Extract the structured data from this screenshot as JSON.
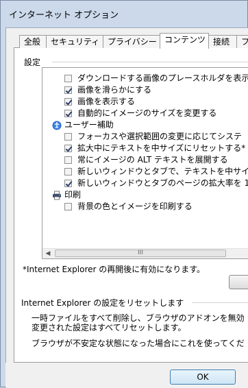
{
  "window": {
    "title": "インターネット オプション"
  },
  "tabs": [
    {
      "label": "全般",
      "active": false
    },
    {
      "label": "セキュリティ",
      "active": false
    },
    {
      "label": "プライバシー",
      "active": false
    },
    {
      "label": "コンテンツ",
      "active": true
    },
    {
      "label": "接続",
      "active": false
    },
    {
      "label": "フ",
      "active": false
    }
  ],
  "settings": {
    "group_label": "設定",
    "items": [
      {
        "type": "checkbox",
        "checked": false,
        "label": "ダウンロードする画像のプレースホルダを表示"
      },
      {
        "type": "checkbox",
        "checked": true,
        "label": "画像を滑らかにする"
      },
      {
        "type": "checkbox",
        "checked": true,
        "label": "画像を表示する"
      },
      {
        "type": "checkbox",
        "checked": true,
        "label": "自動的にイメージのサイズを変更する"
      },
      {
        "type": "category",
        "icon": "accessibility-icon",
        "label": "ユーザー補助"
      },
      {
        "type": "checkbox",
        "checked": false,
        "label": "フォーカスや選択範囲の変更に応じてシステ"
      },
      {
        "type": "checkbox",
        "checked": true,
        "label": "拡大中にテキストを中サイズにリセットする*"
      },
      {
        "type": "checkbox",
        "checked": false,
        "label": "常にイメージの ALT テキストを展開する"
      },
      {
        "type": "checkbox",
        "checked": false,
        "label": "新しいウィンドウとタブで、テキストを中サイズに"
      },
      {
        "type": "checkbox",
        "checked": true,
        "label": "新しいウィンドウとタブのページの拡大率を 1"
      },
      {
        "type": "category",
        "icon": "printer-icon",
        "label": "印刷"
      },
      {
        "type": "checkbox",
        "checked": false,
        "label": "背景の色とイメージを印刷する"
      }
    ],
    "scroll_thumb_glyph": "III",
    "note": "*Internet Explorer の再開後に有効になります。"
  },
  "reset": {
    "group_label": "Internet Explorer の設定をリセットします",
    "line1": "一時ファイルをすべて削除し、ブラウザのアドオンを無効",
    "line2": "変更された設定はすべてリセットします。",
    "line3": "ブラウザが不安定な状態になった場合にこれを使ってくだ"
  },
  "buttons": {
    "ok": "OK"
  }
}
